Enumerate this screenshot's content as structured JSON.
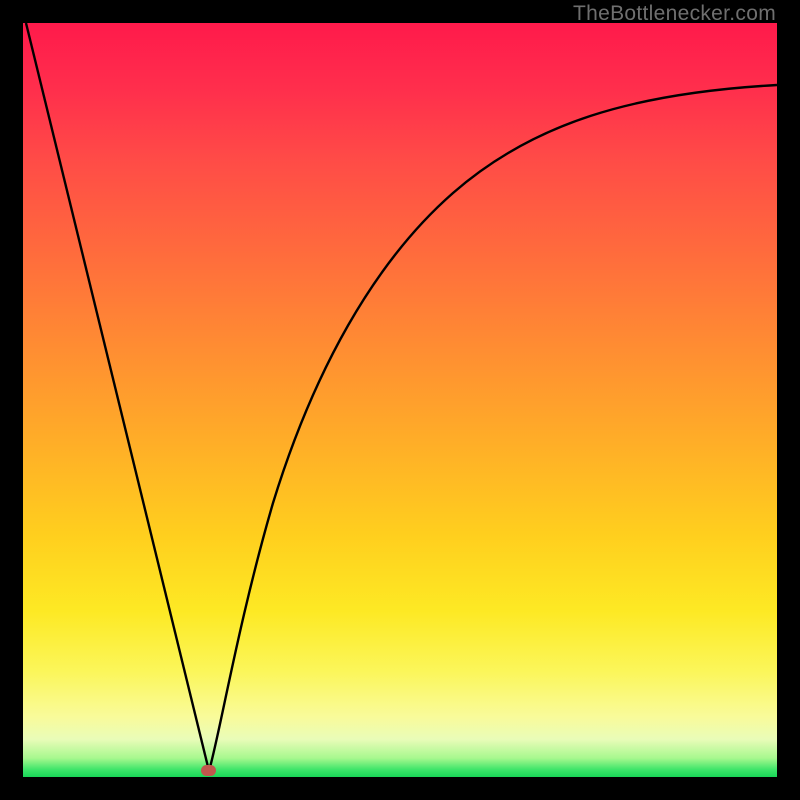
{
  "attribution": "TheBottlenecker.com",
  "colors": {
    "frame": "#000000",
    "gradient_top": "#ff1a4b",
    "gradient_mid": "#ffcf1e",
    "gradient_bottom": "#18d657",
    "curve": "#000000",
    "marker": "#c1574d",
    "attribution_text": "#6f6f6f"
  },
  "chart_data": {
    "type": "line",
    "title": "",
    "xlabel": "",
    "ylabel": "",
    "xlim": [
      0,
      100
    ],
    "ylim": [
      0,
      100
    ],
    "legend": false,
    "grid": false,
    "series": [
      {
        "name": "bottleneck-curve",
        "note": "V-shaped curve; minimum near x≈25 at y≈0; left branch roughly linear to top-left corner; right branch concave rising toward upper right.",
        "x": [
          0,
          5,
          10,
          15,
          20,
          23,
          25,
          26,
          28,
          30,
          33,
          36,
          40,
          45,
          50,
          55,
          60,
          65,
          70,
          75,
          80,
          85,
          90,
          95,
          100
        ],
        "y": [
          100,
          80,
          60,
          40,
          20,
          8,
          0,
          3,
          10,
          18,
          28,
          37,
          47,
          56,
          63,
          69,
          74,
          78,
          81,
          84,
          86,
          88,
          89.5,
          90.7,
          91.7
        ]
      }
    ],
    "annotations": [
      {
        "name": "min-marker",
        "x": 25,
        "y": 0,
        "shape": "rounded-rect",
        "color": "#c1574d"
      }
    ]
  }
}
